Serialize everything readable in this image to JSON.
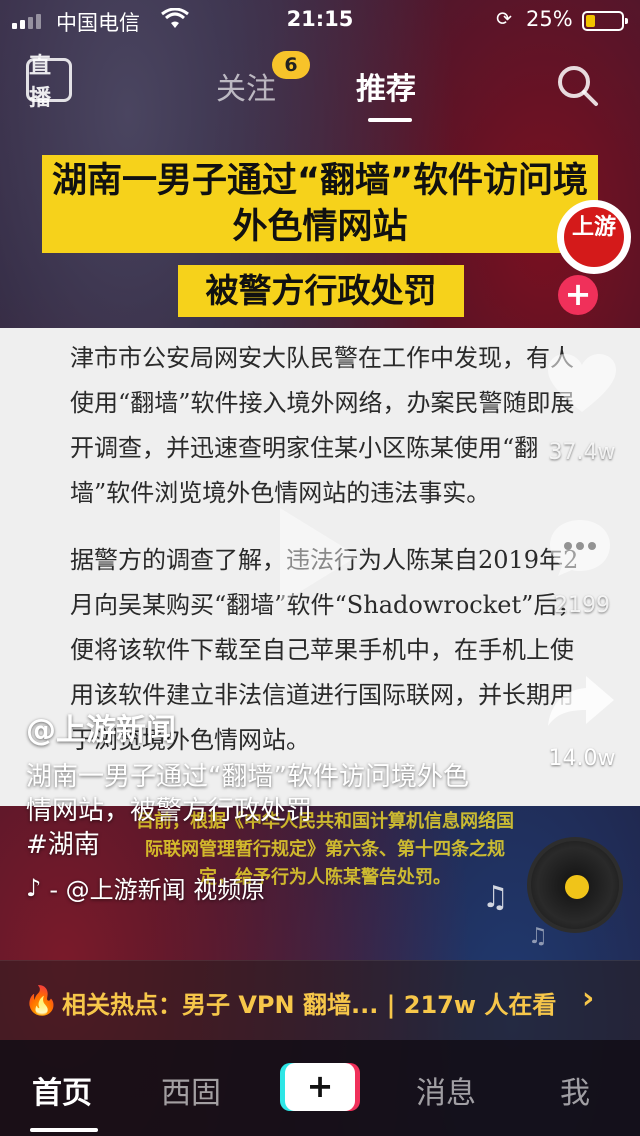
{
  "status_bar": {
    "carrier": "中国电信",
    "time": "21:15",
    "battery": "25%",
    "battery_level": 0.25
  },
  "top_nav": {
    "live_label": "直播",
    "follow_tab": "关注",
    "follow_badge": "6",
    "recommend_tab": "推荐"
  },
  "video": {
    "headline": "湖南一男子通过“翻墙”软件访问境外色情网站",
    "subhead": "被警方行政处罚",
    "doc_paragraphs": [
      "津市市公安局网安大队民警在工作中发现，有人使用“翻墙”软件接入境外网络，办案民警随即展开调查，并迅速查明家住某小区陈某使用“翻墙”软件浏览境外色情网站的违法事实。",
      "据警方的调查了解，违法行为人陈某自2019年2月向吴某购买“翻墙”软件“Shadowrocket”后，便将该软件下载至自己苹果手机中，在手机上使用该软件建立非法信道进行国际联网，并长期用于浏览境外色情网站。"
    ],
    "notice": "目前，根据《中华人民共和国计算机信息网络国际联网管理暂行规定》第六条、第十四条之规定，给予行为人陈某警告处罚。"
  },
  "side_actions": {
    "avatar_text": "上游",
    "like_count": "37.4w",
    "comment_count": "2199",
    "share_count": "14.0w"
  },
  "caption": {
    "author": "@上游新闻",
    "description": "湖南一男子通过“翻墙”软件访问境外色情网站，被警方行政处罚",
    "hashtag": "#湖南",
    "music": "- @上游新闻    视频原"
  },
  "hot_topic": {
    "text": "相关热点：男子 VPN 翻墙... | 217w 人在看"
  },
  "tab_bar": {
    "home": "首页",
    "city": "西固",
    "plus": "+",
    "messages": "消息",
    "me": "我"
  },
  "colors": {
    "accent_yellow": "#f6d21b",
    "badge_yellow": "#f7c32a",
    "hot_text": "#f7c74a",
    "plus_pink": "#f0305a",
    "plus_cyan": "#2ee6e6"
  }
}
